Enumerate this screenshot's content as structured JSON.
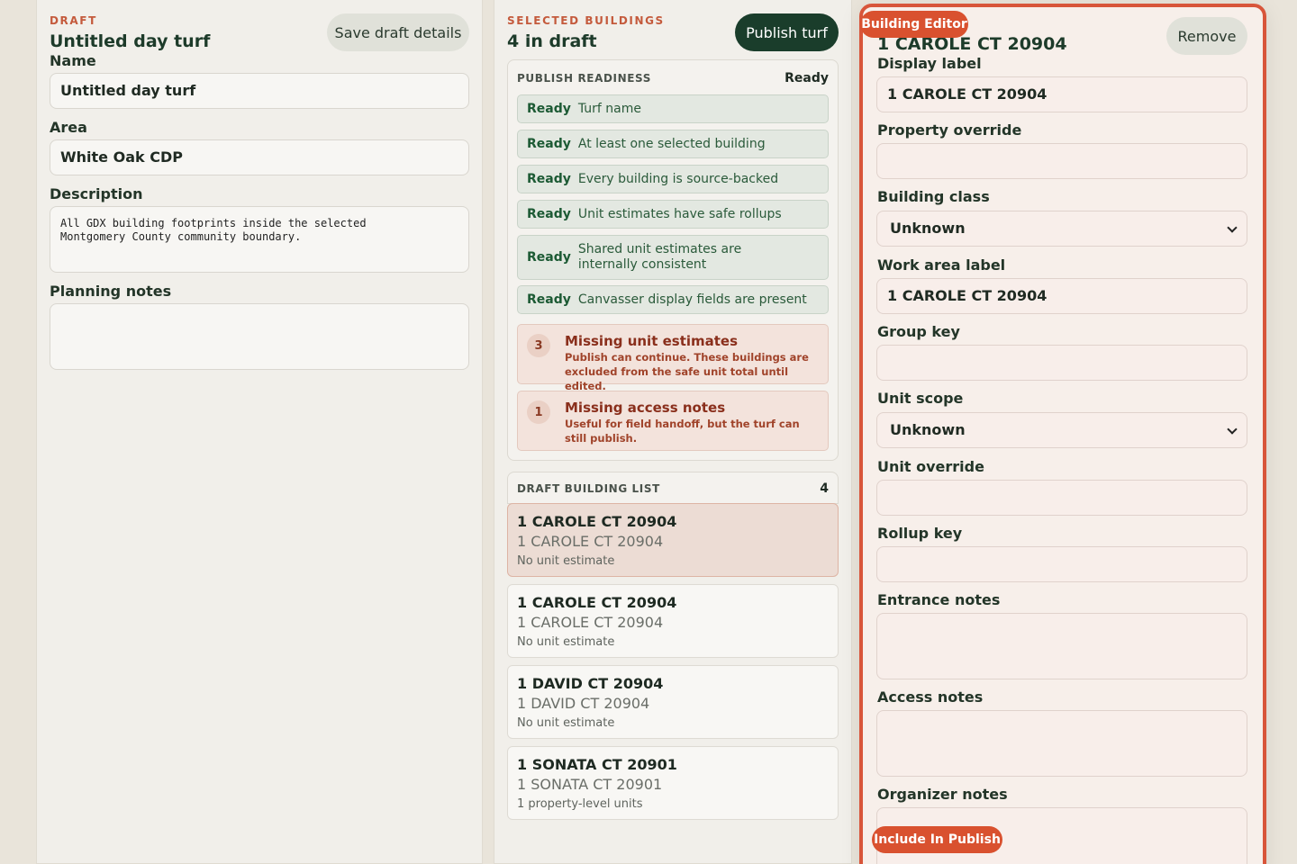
{
  "draft": {
    "kicker": "DRAFT",
    "title": "Untitled day turf",
    "save_label": "Save draft details",
    "name_label": "Name",
    "name_value": "Untitled day turf",
    "area_label": "Area",
    "area_value": "White Oak CDP",
    "description_label": "Description",
    "description_value": "All GDX building footprints inside the selected\nMontgomery County community boundary.",
    "planning_label": "Planning notes",
    "planning_value": ""
  },
  "selected": {
    "kicker": "SELECTED BUILDINGS",
    "title": "4 in draft",
    "publish_label": "Publish turf",
    "readiness": {
      "title": "PUBLISH READINESS",
      "status": "Ready",
      "items": [
        {
          "tag": "Ready",
          "text": "Turf name"
        },
        {
          "tag": "Ready",
          "text": "At least one selected building"
        },
        {
          "tag": "Ready",
          "text": "Every building is source-backed"
        },
        {
          "tag": "Ready",
          "text": "Unit estimates have safe rollups"
        },
        {
          "tag": "Ready",
          "text": "Shared unit estimates are internally consistent"
        },
        {
          "tag": "Ready",
          "text": "Canvasser display fields are present"
        }
      ],
      "warnings": [
        {
          "count": "3",
          "title": "Missing unit estimates",
          "detail": "Publish can continue. These buildings are excluded from the safe unit total until edited."
        },
        {
          "count": "1",
          "title": "Missing access notes",
          "detail": "Useful for field handoff, but the turf can still publish."
        }
      ]
    },
    "list": {
      "title": "DRAFT BUILDING LIST",
      "count": "4",
      "cards": [
        {
          "title": "1 CAROLE CT 20904",
          "subtitle": "1 CAROLE CT 20904",
          "note": "No unit estimate"
        },
        {
          "title": "1 CAROLE CT 20904",
          "subtitle": "1 CAROLE CT 20904",
          "note": "No unit estimate"
        },
        {
          "title": "1 DAVID CT 20904",
          "subtitle": "1 DAVID CT 20904",
          "note": "No unit estimate"
        },
        {
          "title": "1 SONATA CT 20901",
          "subtitle": "1 SONATA CT 20901",
          "note": "1 property-level units"
        }
      ]
    }
  },
  "editor": {
    "badge": "Building Editor",
    "title": "1 CAROLE CT 20904",
    "remove_label": "Remove",
    "display_label": "Display label",
    "display_value": "1 CAROLE CT 20904",
    "property_override_label": "Property override",
    "property_override_value": "",
    "building_class_label": "Building class",
    "building_class_value": "Unknown",
    "work_area_label": "Work area label",
    "work_area_value": "1 CAROLE CT 20904",
    "group_key_label": "Group key",
    "group_key_value": "",
    "unit_scope_label": "Unit scope",
    "unit_scope_value": "Unknown",
    "unit_override_label": "Unit override",
    "unit_override_value": "",
    "rollup_key_label": "Rollup key",
    "rollup_key_value": "",
    "entrance_notes_label": "Entrance notes",
    "access_notes_label": "Access notes",
    "organizer_notes_label": "Organizer notes",
    "include_badge": "Include In Publish"
  }
}
